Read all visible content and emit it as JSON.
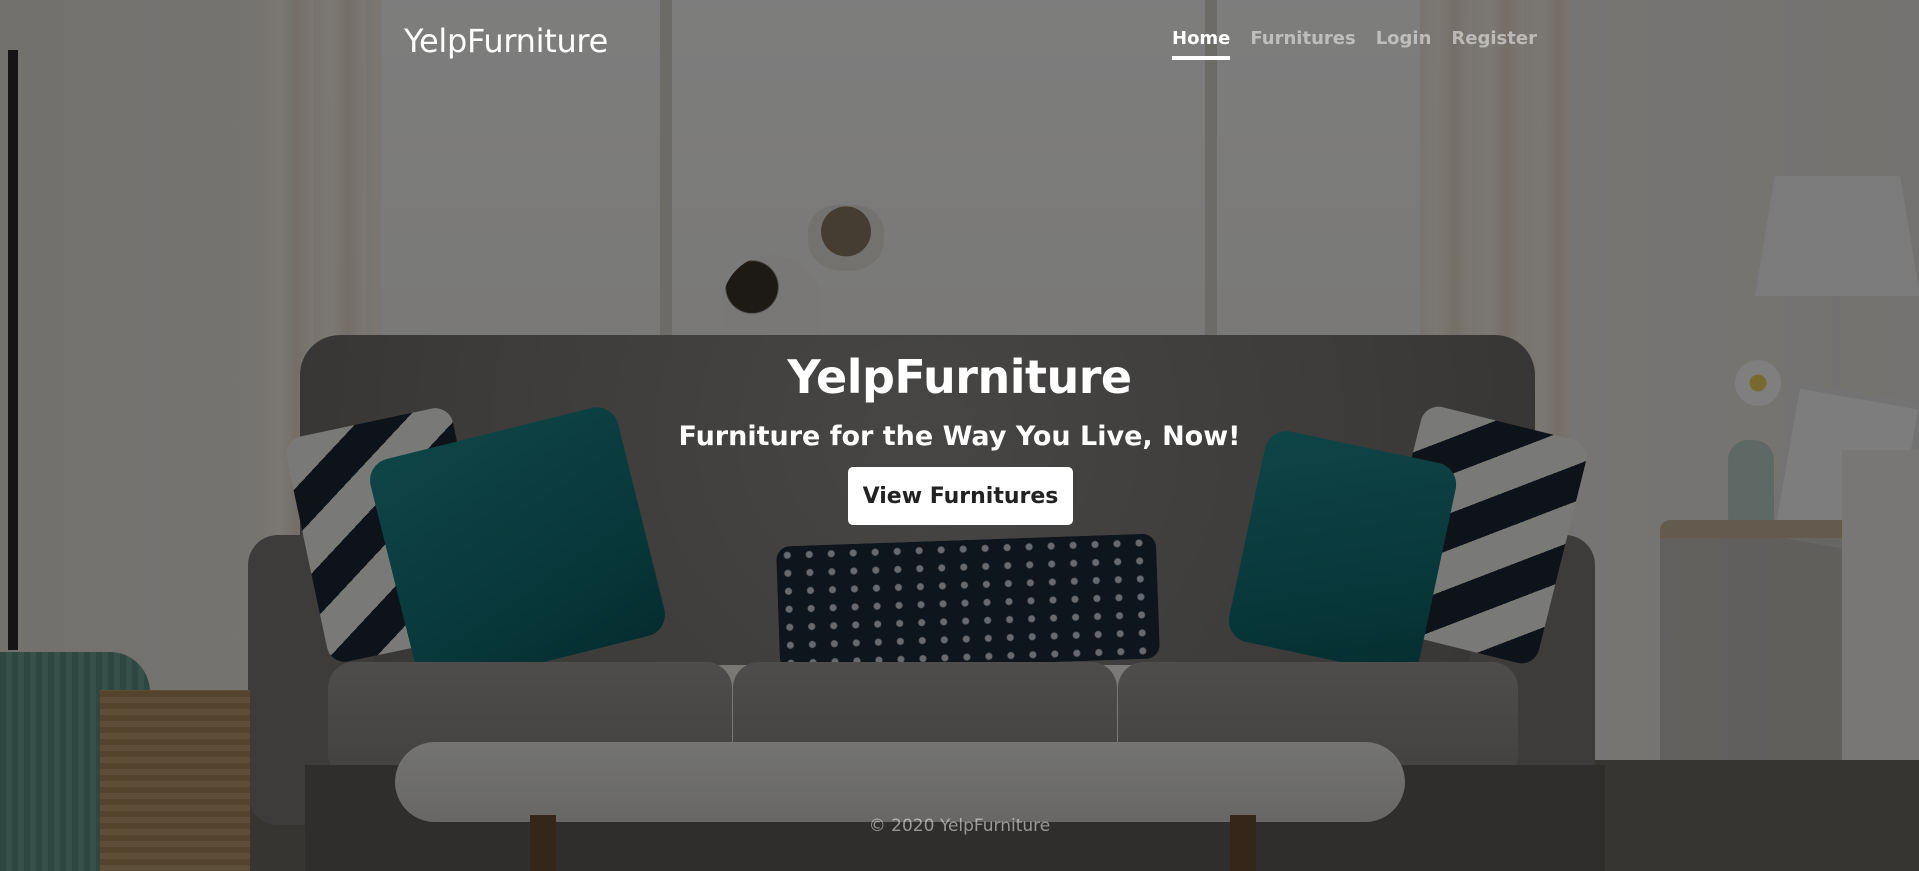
{
  "navbar": {
    "brand": "YelpFurniture",
    "links": [
      {
        "label": "Home",
        "active": true
      },
      {
        "label": "Furnitures",
        "active": false
      },
      {
        "label": "Login",
        "active": false
      },
      {
        "label": "Register",
        "active": false
      }
    ]
  },
  "hero": {
    "title": "YelpFurniture",
    "lead": "Furniture for the Way You Live, Now!",
    "button_label": "View Furnitures"
  },
  "footer": {
    "text": "© 2020 YelpFurniture"
  }
}
